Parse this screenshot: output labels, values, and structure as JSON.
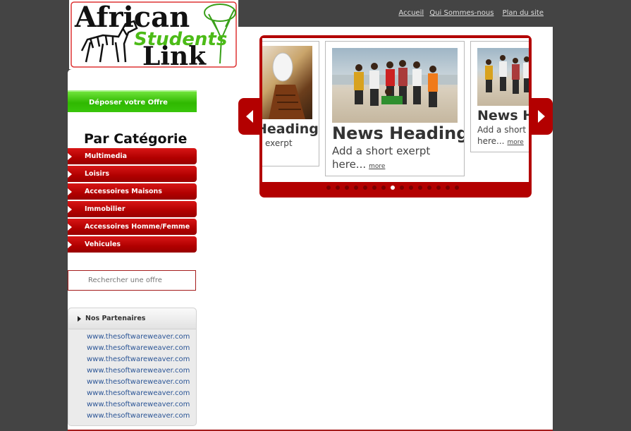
{
  "logo": {
    "line1": "African",
    "line2": "Students",
    "line3": "Link"
  },
  "topnav": {
    "items": [
      "Accueil",
      "Qui Sommes-nous",
      "Plan du site"
    ]
  },
  "sidebar": {
    "deposit_label": "Déposer votre Offre",
    "category_title": "Par Catégorie",
    "categories": [
      "Multimedia",
      "Loisirs",
      "Accessoires Maisons",
      "Immobilier",
      "Accessoires Homme/Femme",
      "Vehicules"
    ],
    "search_placeholder": "Rechercher une offre",
    "partners_title": "Nos Partenaires",
    "partners": [
      "www.thesoftwareweaver.com",
      "www.thesoftwareweaver.com",
      "www.thesoftwareweaver.com",
      "www.thesoftwareweaver.com",
      "www.thesoftwareweaver.com",
      "www.thesoftwareweaver.com",
      "www.thesoftwareweaver.com",
      "www.thesoftwareweaver.com"
    ]
  },
  "slider": {
    "cards": [
      {
        "heading": "Heading",
        "excerpt": "exerpt",
        "more": ""
      },
      {
        "heading": "News Heading",
        "excerpt": "Add a short exerpt",
        "excerpt2": "here...",
        "more": "more"
      },
      {
        "heading": "News H",
        "excerpt": "Add a short e",
        "excerpt2": "here...",
        "more": "more"
      }
    ],
    "dot_count": 15,
    "active_dot": 7
  },
  "colors": {
    "background": "#444444",
    "accent_red": "#b30000",
    "accent_green": "#2fb800",
    "link_blue": "#2b5596"
  }
}
